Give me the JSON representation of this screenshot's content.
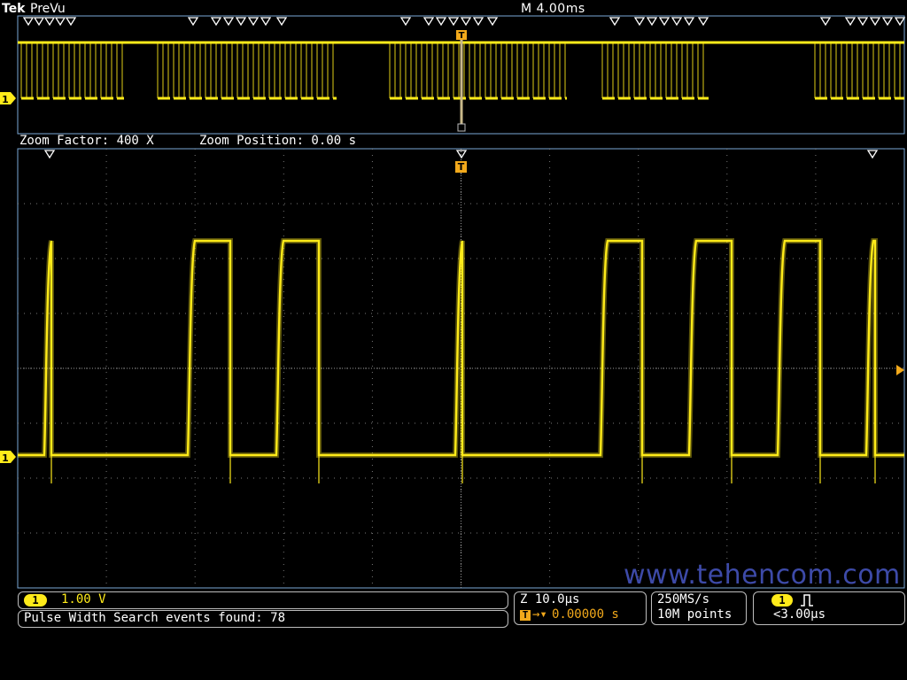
{
  "header": {
    "brand": "Tek",
    "mode": "PreVu",
    "timebase": "M 4.00ms"
  },
  "overview": {
    "channel_marker": "1",
    "trigger_marker": "T"
  },
  "zoom": {
    "factor_label": "Zoom Factor: 400 X",
    "position_label": "Zoom Position: 0.00 s"
  },
  "main": {
    "channel_marker": "1",
    "trigger_marker": "T"
  },
  "status": {
    "channel_badge": "1",
    "channel_scale": "1.00 V",
    "search_result": "Pulse Width Search events found: 78",
    "zoom_scale": "Z 10.0µs",
    "trigger_position": "0.00000 s",
    "sample_rate": "250MS/s",
    "record_length": "10M points",
    "trigger_source": "1",
    "trigger_condition": "<3.00µs"
  },
  "watermark": "www.tehencom.com",
  "colors": {
    "trace": "#ffeb1a",
    "trigger": "#f2a91b",
    "frame": "#7aa9d6",
    "grid": "#8a8a8a"
  }
}
